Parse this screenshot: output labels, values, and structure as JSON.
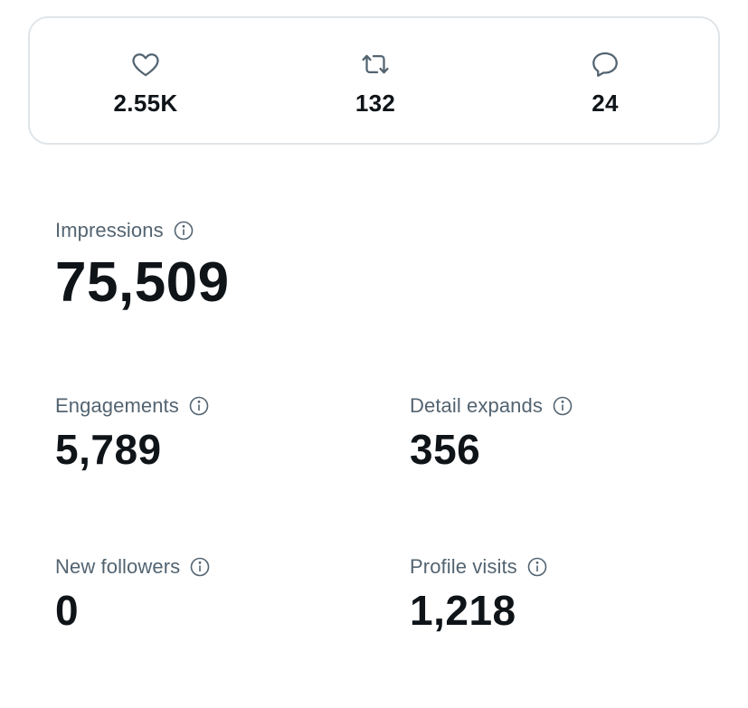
{
  "engagement_bar": {
    "likes": {
      "icon": "heart-icon",
      "count": "2.55K"
    },
    "retweets": {
      "icon": "retweet-icon",
      "count": "132"
    },
    "replies": {
      "icon": "reply-icon",
      "count": "24"
    }
  },
  "metrics": {
    "impressions": {
      "label": "Impressions",
      "value": "75,509"
    },
    "engagements": {
      "label": "Engagements",
      "value": "5,789"
    },
    "detail_expands": {
      "label": "Detail expands",
      "value": "356"
    },
    "new_followers": {
      "label": "New followers",
      "value": "0"
    },
    "profile_visits": {
      "label": "Profile visits",
      "value": "1,218"
    }
  },
  "colors": {
    "text": "#0f1419",
    "muted": "#536471",
    "border": "#dfe5e9"
  }
}
